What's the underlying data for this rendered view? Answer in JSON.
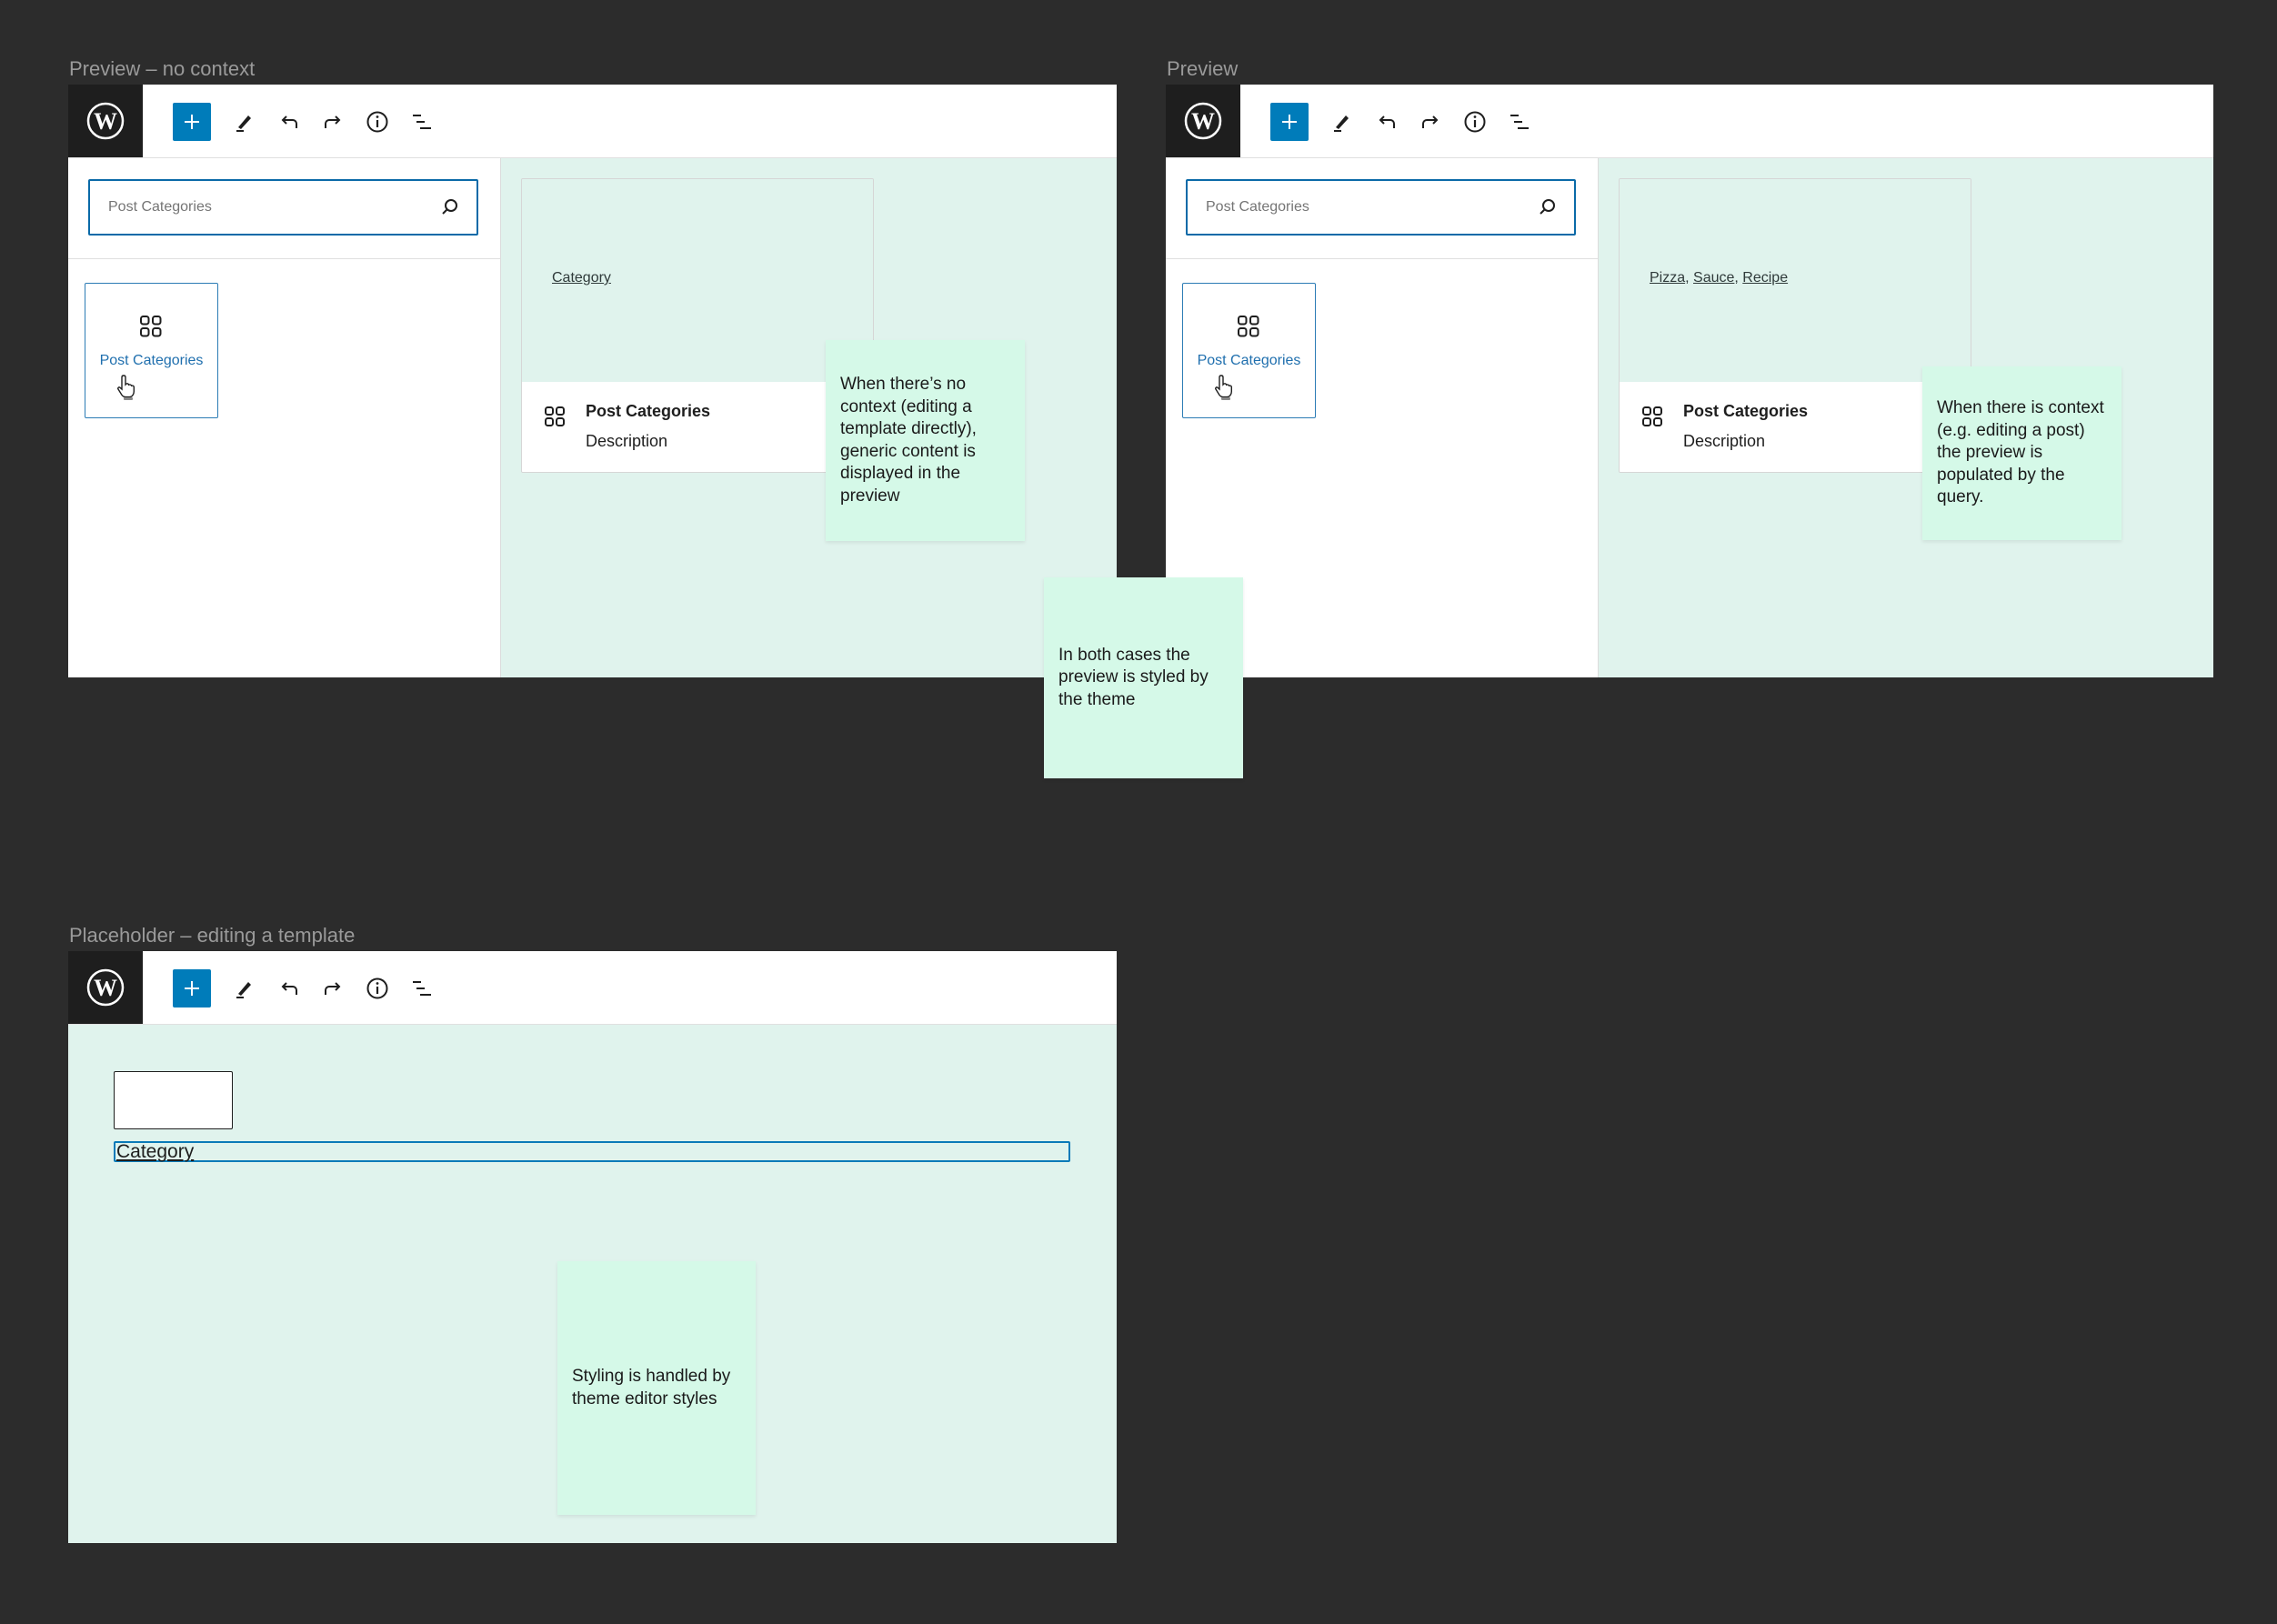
{
  "frames": [
    {
      "label": "Preview – no context",
      "search": {
        "value": "Post Categories"
      },
      "block_item": {
        "label": "Post Categories"
      },
      "preview": {
        "terms": [
          "Category"
        ],
        "title": "Post Categories",
        "description": "Description"
      }
    },
    {
      "label": "Preview",
      "search": {
        "value": "Post Categories"
      },
      "block_item": {
        "label": "Post Categories"
      },
      "preview": {
        "terms": [
          "Pizza",
          "Sauce",
          "Recipe"
        ],
        "title": "Post Categories",
        "description": "Description"
      }
    },
    {
      "label": "Placeholder – editing a template",
      "placeholder": {
        "category_text": "Category"
      }
    }
  ],
  "toolbar": {
    "logo": "wordpress-logo",
    "add_label": "+",
    "icons": [
      "add-block",
      "edit-pencil",
      "undo",
      "redo",
      "info",
      "list-view"
    ]
  },
  "notes": {
    "no_context": "When there’s no context (editing a template directly), generic content is displayed in the preview",
    "with_context": "When there is context (e.g. editing a post) the preview is populated by the query.",
    "both_cases": "In both cases the preview is styled by the theme",
    "styling": "Styling is handled by theme editor styles"
  },
  "colors": {
    "background": "#2c2c2c",
    "accent": "#007cba",
    "canvas": "#e0f3ed",
    "sticky": "#d5f9e8",
    "logo_bg": "#1e1e1e"
  }
}
